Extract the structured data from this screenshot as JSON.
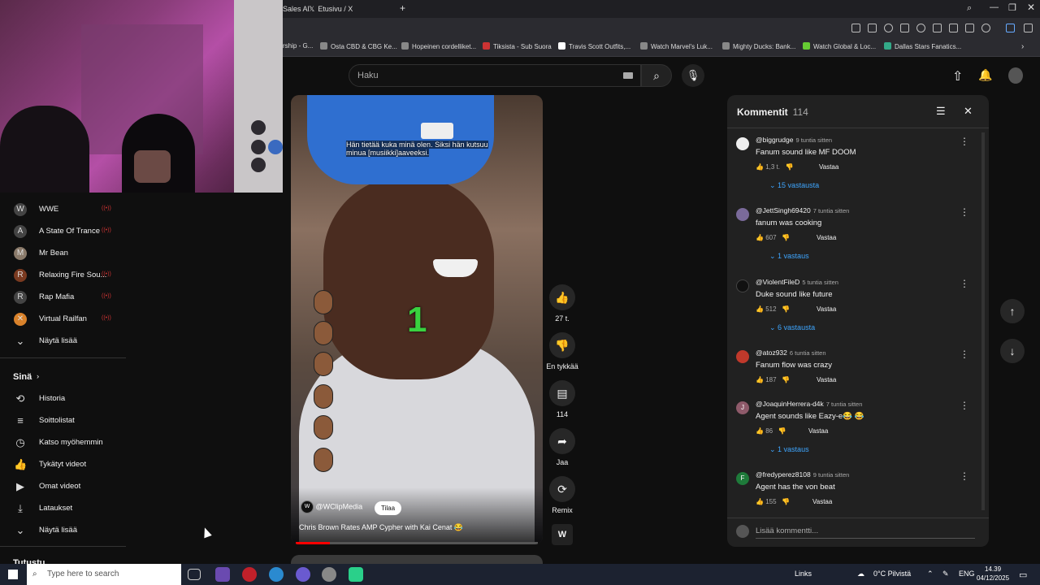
{
  "browser": {
    "tabs": [
      {
        "label": "Sales Al"
      },
      {
        "label": "Etusivu / X"
      }
    ],
    "bookmarks": [
      "rship - G...",
      "Osta CBD & CBG Ke...",
      "Hopeinen cordelliket...",
      "Tiksista - Sub Suora",
      "Travis Scott Outfits,...",
      "Watch Marvel's Luk...",
      "Mighty Ducks: Bank...",
      "Watch Global & Loc...",
      "Dallas Stars Fanatics..."
    ]
  },
  "search": {
    "placeholder": "Haku",
    "search_icon": "⌕",
    "mic_icon": "🎙"
  },
  "sidebar": {
    "subscriptions": [
      {
        "label": "WWE",
        "icon": "W"
      },
      {
        "label": "A State Of Trance",
        "icon": "A"
      },
      {
        "label": "Mr Bean",
        "icon": "M"
      },
      {
        "label": "Relaxing Fire Sou...",
        "icon": "R"
      },
      {
        "label": "Rap Mafia",
        "icon": "R"
      },
      {
        "label": "Virtual Railfan",
        "icon": "✕"
      }
    ],
    "show_more": "Näytä lisää",
    "you_section": "Sinä",
    "you_items": [
      {
        "label": "Historia",
        "icon": "⟲"
      },
      {
        "label": "Soittolistat",
        "icon": "≡"
      },
      {
        "label": "Katso myöhemmin",
        "icon": "◷"
      },
      {
        "label": "Tykätyt videot",
        "icon": "👍"
      },
      {
        "label": "Omat videot",
        "icon": "▶"
      },
      {
        "label": "Lataukset",
        "icon": "⤓"
      }
    ],
    "show_more_2": "Näytä lisää",
    "explore": "Tutustu"
  },
  "video": {
    "caption_line1": "Hän tietää kuka minä olen. Siksi hän kutsuu",
    "caption_line2": "minua [musiikki]aaveeksi.",
    "score": "1",
    "channel": "@WClipMedia",
    "channel_logo": "W",
    "subscribe": "Tilaa",
    "title": "Chris Brown Rates AMP Cypher with Kai Cenat 😂",
    "progress": 0.14
  },
  "actions": {
    "like_count": "27 t.",
    "dislike_label": "En tykkää",
    "comment_count": "114",
    "share_label": "Jaa",
    "remix_label": "Remix"
  },
  "comments": {
    "title": "Kommentit",
    "count": "114",
    "add_placeholder": "Lisää kommentti...",
    "items": [
      {
        "user": "@biggrudge",
        "time": "9 tuntia sitten",
        "text": "Fanum sound like MF DOOM",
        "likes": "1,3 t.",
        "reply": "Vastaa",
        "replies": "15 vastausta",
        "avatar": "",
        "avatar_color": "#eeeeee"
      },
      {
        "user": "@JettSingh69420",
        "time": "7 tuntia sitten",
        "text": "fanum was cooking",
        "likes": "607",
        "reply": "Vastaa",
        "replies": "1 vastaus",
        "avatar": "",
        "avatar_color": "#7a6a9a"
      },
      {
        "user": "@ViolentFileD",
        "time": "5 tuntia sitten",
        "text": "Duke sound like future",
        "likes": "512",
        "reply": "Vastaa",
        "replies": "6 vastausta",
        "avatar": "",
        "avatar_color": "#111111"
      },
      {
        "user": "@atoz932",
        "time": "6 tuntia sitten",
        "text": "Fanum flow was crazy",
        "likes": "187",
        "reply": "Vastaa",
        "replies": "",
        "avatar": "",
        "avatar_color": "#c0392b"
      },
      {
        "user": "@JoaquinHerrera-d4k",
        "time": "7 tuntia sitten",
        "text": "Agent sounds like Eazy-e😂 😂",
        "likes": "86",
        "reply": "Vastaa",
        "replies": "1 vastaus",
        "avatar": "J",
        "avatar_color": "#8e5a6a"
      },
      {
        "user": "@fredyperez8108",
        "time": "9 tuntia sitten",
        "text": "Agent has the von beat",
        "likes": "155",
        "reply": "Vastaa",
        "replies": "",
        "avatar": "F",
        "avatar_color": "#1e7a3a"
      }
    ]
  },
  "taskbar": {
    "search_placeholder": "Type here to search",
    "links": "Links",
    "weather": "0°C  Pilvistä",
    "lang": "ENG",
    "time": "14.39",
    "date": "04/12/2025"
  }
}
